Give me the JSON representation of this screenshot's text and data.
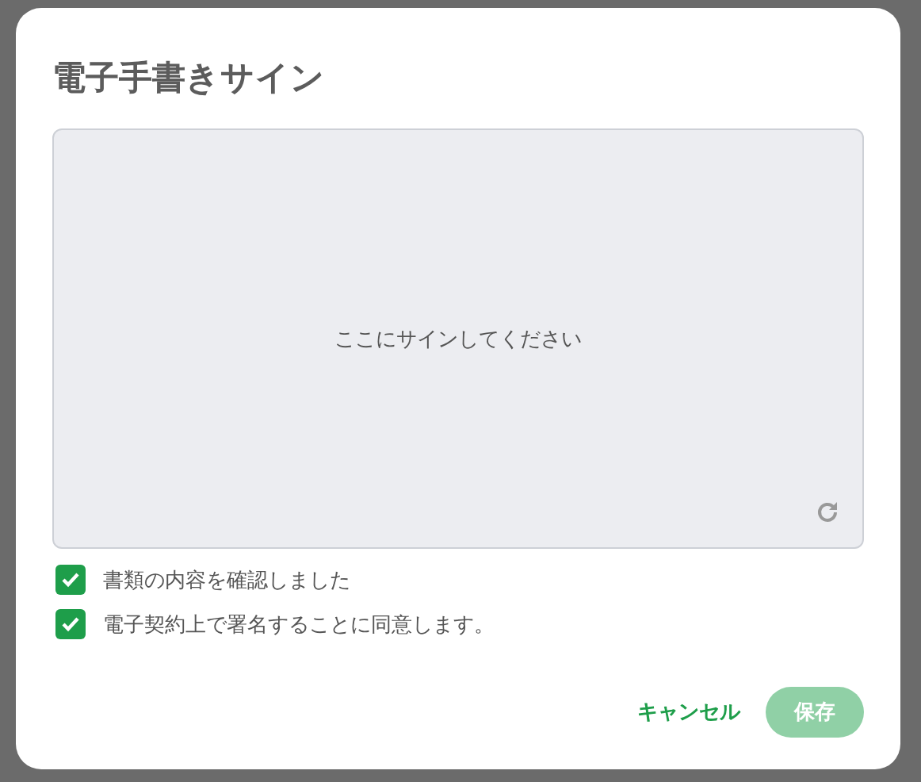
{
  "dialog": {
    "title": "電子手書きサイン",
    "signature_pad": {
      "placeholder": "ここにサインしてください"
    },
    "checkboxes": [
      {
        "label": "書類の内容を確認しました",
        "checked": true
      },
      {
        "label": "電子契約上で署名することに同意します。",
        "checked": true
      }
    ],
    "buttons": [
      {
        "label": "キャンセル",
        "kind": "text",
        "disabled": false
      },
      {
        "label": "保存",
        "kind": "primary",
        "disabled": true
      }
    ]
  }
}
